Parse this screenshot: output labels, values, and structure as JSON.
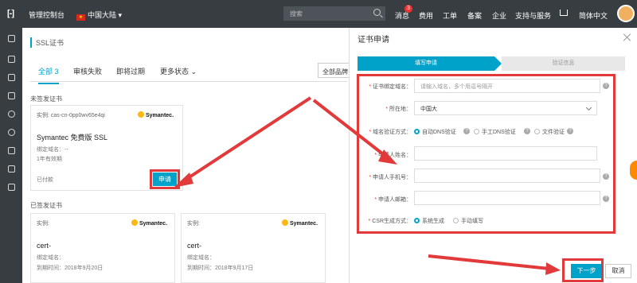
{
  "topbar": {
    "logo": "[-]",
    "console": "管理控制台",
    "region": "中国大陆",
    "search_placeholder": "搜索",
    "nav": [
      "消息",
      "费用",
      "工单",
      "备案",
      "企业",
      "支持与服务",
      "简体中文"
    ],
    "message_count": "3"
  },
  "main": {
    "title": "SSL证书",
    "tabs": [
      "全部 3",
      "审核失败",
      "即将过期",
      "更多状态"
    ],
    "all_domains": "全部品牌",
    "unissued_title": "未签发证书",
    "issued_title": "已签发证书"
  },
  "cards": [
    {
      "instance": "实例: cas-cn-0pp0wv65e4qi",
      "brand": "Symantec.",
      "name": "Symantec 免费版 SSL",
      "domain": "绑定域名：--",
      "validity": "1年有效期",
      "status": "已付款",
      "action": "申请"
    },
    {
      "instance": "实例:",
      "brand": "Symantec.",
      "name": "cert-",
      "domain": "绑定域名：",
      "expiry": "到期时间：2018年9月20日"
    },
    {
      "instance": "实例:",
      "brand": "Symantec.",
      "name": "cert-",
      "domain": "绑定域名：",
      "expiry": "到期时间：2018年9月17日"
    }
  ],
  "panel": {
    "title": "证书申请",
    "steps": [
      "填写申请",
      "验证信息"
    ],
    "fields": [
      {
        "label": "证书绑定域名：",
        "placeholder": "请输入域名，多个用逗号隔开"
      },
      {
        "label": "所在地：",
        "value": "中国大"
      },
      {
        "label": "域名验证方式：",
        "options": [
          "自动DNS验证",
          "手工DNS验证",
          "文件验证"
        ]
      },
      {
        "label": "申请人姓名：",
        "value": ""
      },
      {
        "label": "申请人手机号：",
        "value": ""
      },
      {
        "label": "申请人邮箱：",
        "value": ""
      },
      {
        "label": "CSR生成方式：",
        "options": [
          "系统生成",
          "手动填写"
        ]
      }
    ],
    "next": "下一步",
    "cancel": "取消"
  },
  "colors": {
    "accent": "#00a2ca",
    "highlight": "#e23a3a",
    "topbar": "#373d41"
  }
}
